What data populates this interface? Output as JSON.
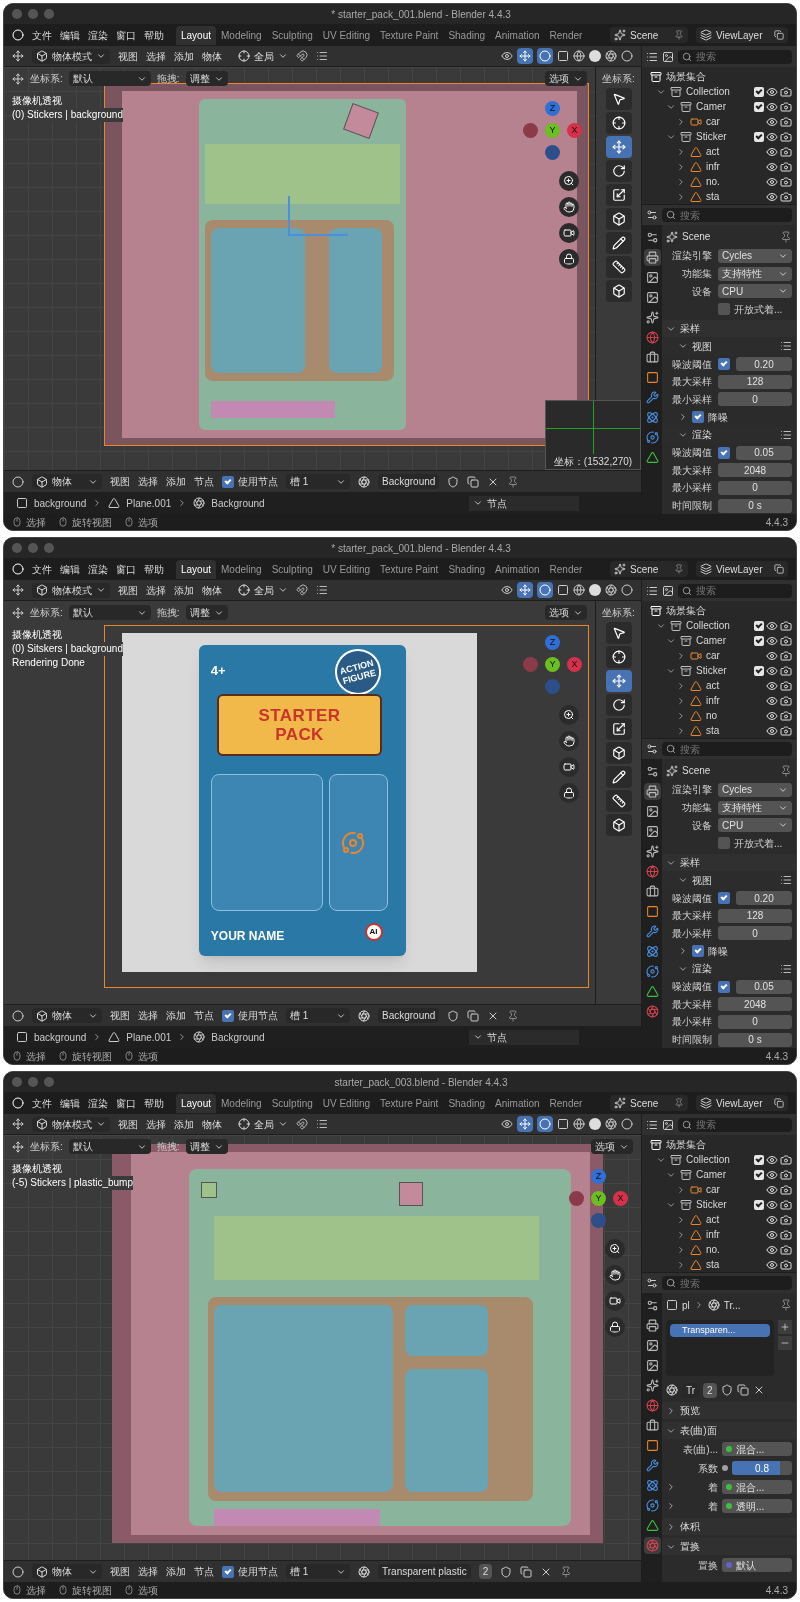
{
  "windows": [
    {
      "title": "* starter_pack_001.blend - Blender 4.4.3",
      "menus": [
        "文件",
        "编辑",
        "渲染",
        "窗口",
        "帮助"
      ],
      "workspaces": [
        {
          "label": "Layout",
          "selected": true
        },
        {
          "label": "Modeling",
          "selected": false
        },
        {
          "label": "Sculpting",
          "selected": false
        },
        {
          "label": "UV Editing",
          "selected": false
        },
        {
          "label": "Texture Paint",
          "selected": false
        },
        {
          "label": "Shading",
          "selected": false
        },
        {
          "label": "Animation",
          "selected": false
        },
        {
          "label": "Render",
          "selected": false
        }
      ],
      "scene": "Scene",
      "view_layer": "ViewLayer",
      "header": {
        "mode": "物体模式",
        "menus": [
          "视图",
          "选择",
          "添加",
          "物体"
        ],
        "orientation": "全局",
        "coord_label": "坐标系:",
        "coord_value": "默认",
        "drag_label": "拖拽:",
        "drag_value": "调整",
        "options": "选项"
      },
      "overlay": [
        "摄像机透视",
        "(0) Stickers | background"
      ],
      "viewport": {
        "kind": "solid"
      },
      "gizmo": [
        "Z",
        "Y",
        "X"
      ],
      "split_view": {
        "label": "坐标系:"
      },
      "coord_popup": "坐标：(1532,270)",
      "outliner": {
        "placeholder": "搜索",
        "tree": [
          {
            "label": "场景集合",
            "kind": "scene",
            "children": [
              {
                "label": "Collection",
                "kind": "collection",
                "expanded": true,
                "checked": true,
                "children": [
                  {
                    "label": "Camer",
                    "kind": "collection",
                    "expanded": true,
                    "checked": true,
                    "children": [
                      {
                        "label": "car",
                        "kind": "camera",
                        "expanded": false
                      }
                    ]
                  },
                  {
                    "label": "Sticker",
                    "kind": "collection",
                    "expanded": true,
                    "checked": true,
                    "children": [
                      {
                        "label": "act",
                        "kind": "mesh",
                        "expanded": false
                      },
                      {
                        "label": "infr",
                        "kind": "mesh",
                        "expanded": false
                      },
                      {
                        "label": "no.",
                        "kind": "mesh",
                        "expanded": false
                      },
                      {
                        "label": "sta",
                        "kind": "mesh",
                        "expanded": false
                      }
                    ]
                  }
                ]
              }
            ]
          }
        ]
      },
      "properties": {
        "placeholder": "搜索",
        "tabs": [
          {
            "selected": false
          },
          {
            "selected": true
          },
          {
            "selected": false
          },
          {
            "selected": false
          },
          {
            "selected": false
          },
          {
            "selected": false
          },
          {
            "selected": false
          },
          {
            "selected": false
          },
          {
            "selected": false
          },
          {
            "selected": false
          },
          {
            "selected": false
          },
          {
            "selected": false
          }
        ],
        "rows": [
          {
            "kind": "title",
            "text": "Scene"
          },
          {
            "kind": "dropdown",
            "label": "渲染引擎",
            "value": "Cycles"
          },
          {
            "kind": "dropdown",
            "label": "功能集",
            "value": "支持特性"
          },
          {
            "kind": "dropdown",
            "label": "设备",
            "value": "CPU"
          },
          {
            "kind": "checkbox",
            "label": "开放式着...",
            "checked": false
          },
          {
            "kind": "section",
            "label": "采样",
            "expanded": true
          },
          {
            "kind": "subsection",
            "label": "视图",
            "expanded": true
          },
          {
            "kind": "check_number",
            "label": "噪波阈值",
            "checked": true,
            "value": "0.20"
          },
          {
            "kind": "number",
            "label": "最大采样",
            "value": "128"
          },
          {
            "kind": "number",
            "label": "最小采样",
            "value": "0"
          },
          {
            "kind": "subcheck",
            "label": "降噪",
            "checked": true,
            "expanded": false
          },
          {
            "kind": "subsection",
            "label": "渲染",
            "expanded": true
          },
          {
            "kind": "check_number",
            "label": "噪波阈值",
            "checked": true,
            "value": "0.05"
          },
          {
            "kind": "number",
            "label": "最大采样",
            "value": "2048"
          },
          {
            "kind": "number",
            "label": "最小采样",
            "value": "0"
          },
          {
            "kind": "number",
            "label": "时间限制",
            "value": "0 s"
          }
        ]
      },
      "node_editor": {
        "mode": "物体",
        "menus": [
          "视图",
          "选择",
          "添加",
          "节点"
        ],
        "use_nodes_label": "使用节点",
        "use_nodes": true,
        "slot": "槽 1",
        "material": "Background",
        "breadcrumb": [
          "background",
          "Plane.001",
          "Background"
        ],
        "panel": "节点"
      },
      "status": {
        "items": [
          "选择",
          "旋转视图",
          "选项"
        ],
        "version": "4.4.3"
      }
    },
    {
      "title": "* starter_pack_001.blend - Blender 4.4.3",
      "menus": [
        "文件",
        "编辑",
        "渲染",
        "窗口",
        "帮助"
      ],
      "workspaces": [
        {
          "label": "Layout",
          "selected": true
        },
        {
          "label": "Modeling",
          "selected": false
        },
        {
          "label": "Sculpting",
          "selected": false
        },
        {
          "label": "UV Editing",
          "selected": false
        },
        {
          "label": "Texture Paint",
          "selected": false
        },
        {
          "label": "Shading",
          "selected": false
        },
        {
          "label": "Animation",
          "selected": false
        },
        {
          "label": "Render",
          "selected": false
        }
      ],
      "scene": "Scene",
      "view_layer": "ViewLayer",
      "header": {
        "mode": "物体模式",
        "menus": [
          "视图",
          "选择",
          "添加",
          "物体"
        ],
        "orientation": "全局",
        "coord_label": "坐标系:",
        "coord_value": "默认",
        "drag_label": "拖拽:",
        "drag_value": "调整",
        "options": "选项"
      },
      "overlay": [
        "摄像机透视",
        "(0) Sitskers | background",
        "Rendering Done"
      ],
      "viewport": {
        "kind": "render",
        "badge": "4+",
        "headline": [
          "STARTER",
          "PACK"
        ],
        "sticker": [
          "ACTION",
          "FIGURE"
        ],
        "name": "YOUR NAME",
        "mark": "AI"
      },
      "gizmo": [
        "Z",
        "Y",
        "X"
      ],
      "split_view": {
        "label": "坐标系:"
      },
      "outliner": {
        "placeholder": "搜索",
        "tree": [
          {
            "label": "场景集合",
            "kind": "scene",
            "children": [
              {
                "label": "Collection",
                "kind": "collection",
                "expanded": true,
                "checked": true,
                "children": [
                  {
                    "label": "Camer",
                    "kind": "collection",
                    "expanded": true,
                    "checked": true,
                    "children": [
                      {
                        "label": "car",
                        "kind": "camera",
                        "expanded": false
                      }
                    ]
                  },
                  {
                    "label": "Sticker",
                    "kind": "collection",
                    "expanded": true,
                    "checked": true,
                    "children": [
                      {
                        "label": "act",
                        "kind": "mesh",
                        "expanded": false
                      },
                      {
                        "label": "infr",
                        "kind": "mesh",
                        "expanded": false
                      },
                      {
                        "label": "no",
                        "kind": "mesh",
                        "expanded": false
                      },
                      {
                        "label": "sta",
                        "kind": "mesh",
                        "expanded": false
                      }
                    ]
                  }
                ]
              }
            ]
          }
        ]
      },
      "properties": {
        "placeholder": "搜索",
        "tabs": [
          {
            "selected": false
          },
          {
            "selected": true
          },
          {
            "selected": false
          },
          {
            "selected": false
          },
          {
            "selected": false
          },
          {
            "selected": false
          },
          {
            "selected": false
          },
          {
            "selected": false
          },
          {
            "selected": false
          },
          {
            "selected": false
          },
          {
            "selected": false
          },
          {
            "selected": false
          },
          {
            "selected": false
          }
        ],
        "rows": [
          {
            "kind": "title",
            "text": "Scene"
          },
          {
            "kind": "dropdown",
            "label": "渲染引擎",
            "value": "Cycles"
          },
          {
            "kind": "dropdown",
            "label": "功能集",
            "value": "支持特性"
          },
          {
            "kind": "dropdown",
            "label": "设备",
            "value": "CPU"
          },
          {
            "kind": "checkbox",
            "label": "开放式着...",
            "checked": false
          },
          {
            "kind": "section",
            "label": "采样",
            "expanded": true
          },
          {
            "kind": "subsection",
            "label": "视图",
            "expanded": true
          },
          {
            "kind": "check_number",
            "label": "噪波阈值",
            "checked": true,
            "value": "0.20"
          },
          {
            "kind": "number",
            "label": "最大采样",
            "value": "128"
          },
          {
            "kind": "number",
            "label": "最小采样",
            "value": "0"
          },
          {
            "kind": "subcheck",
            "label": "降噪",
            "checked": true,
            "expanded": false
          },
          {
            "kind": "subsection",
            "label": "渲染",
            "expanded": true
          },
          {
            "kind": "check_number",
            "label": "噪波阈值",
            "checked": true,
            "value": "0.05"
          },
          {
            "kind": "number",
            "label": "最大采样",
            "value": "2048"
          },
          {
            "kind": "number",
            "label": "最小采样",
            "value": "0"
          },
          {
            "kind": "number",
            "label": "时间限制",
            "value": "0 s"
          }
        ]
      },
      "node_editor": {
        "mode": "物体",
        "menus": [
          "视图",
          "选择",
          "添加",
          "节点"
        ],
        "use_nodes_label": "使用节点",
        "use_nodes": true,
        "slot": "槽 1",
        "material": "Background",
        "breadcrumb": [
          "background",
          "Plane.001",
          "Background"
        ],
        "panel": "节点"
      },
      "status": {
        "items": [
          "选择",
          "旋转视图",
          "选项"
        ],
        "version": "4.4.3"
      }
    },
    {
      "title": "starter_pack_003.blend - Blender 4.4.3",
      "menus": [
        "文件",
        "编辑",
        "渲染",
        "窗口",
        "帮助"
      ],
      "workspaces": [
        {
          "label": "Layout",
          "selected": true
        },
        {
          "label": "Modeling",
          "selected": false
        },
        {
          "label": "Sculpting",
          "selected": false
        },
        {
          "label": "UV Editing",
          "selected": false
        },
        {
          "label": "Texture Paint",
          "selected": false
        },
        {
          "label": "Shading",
          "selected": false
        },
        {
          "label": "Animation",
          "selected": false
        },
        {
          "label": "Render",
          "selected": false
        }
      ],
      "scene": "Scene",
      "view_layer": "ViewLayer",
      "header": {
        "mode": "物体模式",
        "menus": [
          "视图",
          "选择",
          "添加",
          "物体"
        ],
        "orientation": "全局",
        "coord_label": "坐标系:",
        "coord_value": "默认",
        "drag_label": "拖拽:",
        "drag_value": "调整",
        "options": "选项"
      },
      "overlay": [
        "摄像机透视",
        "(-5) Stickers | plastic_bump"
      ],
      "viewport": {
        "kind": "solid_three"
      },
      "gizmo": [
        "Z",
        "Y",
        "X"
      ],
      "outliner": {
        "placeholder": "搜索",
        "tree": [
          {
            "label": "场景集合",
            "kind": "scene",
            "children": [
              {
                "label": "Collection",
                "kind": "collection",
                "expanded": true,
                "checked": true,
                "children": [
                  {
                    "label": "Camer",
                    "kind": "collection",
                    "expanded": true,
                    "checked": true,
                    "children": [
                      {
                        "label": "car",
                        "kind": "camera",
                        "expanded": false
                      }
                    ]
                  },
                  {
                    "label": "Sticker",
                    "kind": "collection",
                    "expanded": true,
                    "checked": true,
                    "children": [
                      {
                        "label": "act",
                        "kind": "mesh",
                        "expanded": false
                      },
                      {
                        "label": "infr",
                        "kind": "mesh",
                        "expanded": false
                      },
                      {
                        "label": "no.",
                        "kind": "mesh",
                        "expanded": false
                      },
                      {
                        "label": "sta",
                        "kind": "mesh",
                        "expanded": false
                      }
                    ]
                  }
                ]
              }
            ]
          }
        ]
      },
      "properties": {
        "placeholder": "搜索",
        "tabs": [
          {
            "selected": false
          },
          {
            "selected": false
          },
          {
            "selected": false
          },
          {
            "selected": false
          },
          {
            "selected": false
          },
          {
            "selected": false
          },
          {
            "selected": false
          },
          {
            "selected": false
          },
          {
            "selected": false
          },
          {
            "selected": false
          },
          {
            "selected": false
          },
          {
            "selected": false
          },
          {
            "selected": true
          }
        ],
        "rows": [
          {
            "kind": "path",
            "parts": [
              "pl",
              "Tr..."
            ]
          },
          {
            "kind": "slot_list",
            "items": [
              "Transparen..."
            ]
          },
          {
            "kind": "material_bar",
            "name": "Tr",
            "users": "2"
          },
          {
            "kind": "section",
            "label": "预览",
            "expanded": false
          },
          {
            "kind": "section",
            "label": "表(曲)面",
            "expanded": true
          },
          {
            "kind": "socket",
            "label": "表(曲)...",
            "value": "混合...",
            "color": "#3fbf3f"
          },
          {
            "kind": "slider",
            "label": "系数",
            "value": "0.8",
            "level": 0.8
          },
          {
            "kind": "socket",
            "label": "着",
            "value": "混合...",
            "color": "#3fbf3f",
            "expanded": false
          },
          {
            "kind": "socket",
            "label": "着",
            "value": "透明...",
            "color": "#3fbf3f",
            "expanded": false
          },
          {
            "kind": "section",
            "label": "体积",
            "expanded": false
          },
          {
            "kind": "section",
            "label": "置换",
            "expanded": true
          },
          {
            "kind": "socket",
            "label": "置换",
            "value": "默认",
            "color": "#6363c7"
          }
        ]
      },
      "node_editor": {
        "mode": "物体",
        "menus": [
          "视图",
          "选择",
          "添加",
          "节点"
        ],
        "use_nodes_label": "使用节点",
        "use_nodes": true,
        "slot": "槽 1",
        "material": "Transparent plastic",
        "users": "2"
      },
      "status": {
        "items": [
          "选择",
          "旋转视图",
          "选项"
        ],
        "version": "4.4.3"
      }
    }
  ]
}
